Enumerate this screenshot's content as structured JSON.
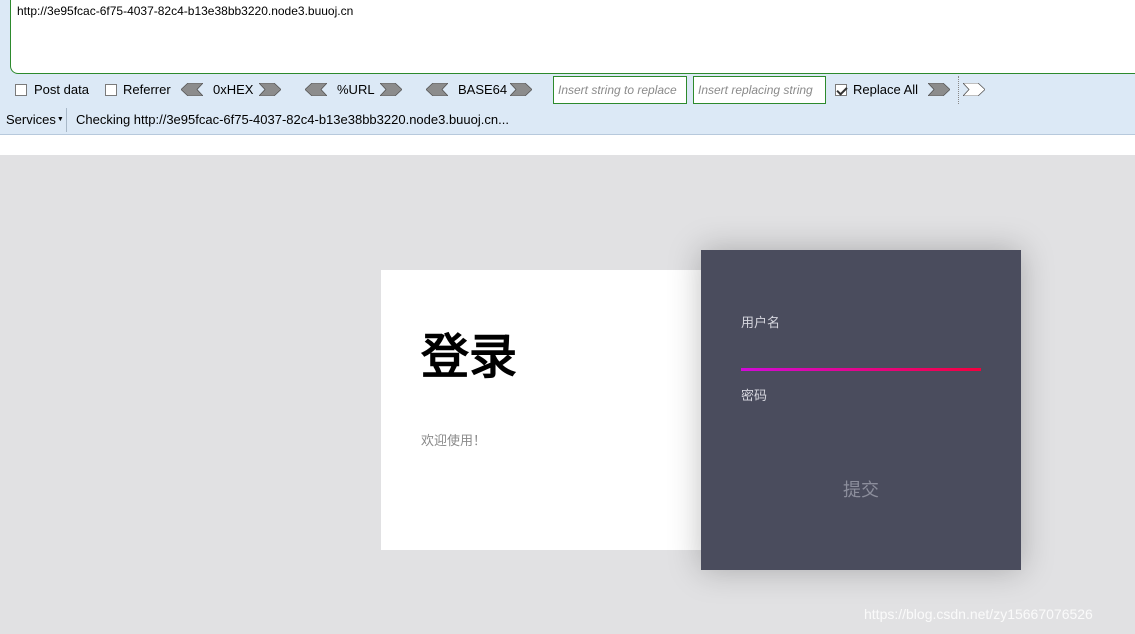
{
  "hackbar": {
    "url": "http://3e95fcac-6f75-4037-82c4-b13e38bb3220.node3.buuoj.cn",
    "post_data_label": "Post data",
    "post_data_checked": false,
    "referrer_label": "Referrer",
    "referrer_checked": false,
    "hex_label": "0xHEX",
    "url_label": "%URL",
    "base64_label": "BASE64",
    "replace_find_placeholder": "Insert string to replace",
    "replace_with_placeholder": "Insert replacing string",
    "replace_all_label": "Replace All",
    "replace_all_checked": true,
    "services_label": "Services",
    "status_text": "Checking http://3e95fcac-6f75-4037-82c4-b13e38bb3220.node3.buuoj.cn..."
  },
  "login": {
    "title": "登录",
    "subtitle": "欢迎使用！",
    "username_label": "用户名",
    "password_label": "密码",
    "submit_label": "提交"
  },
  "watermark": "https://blog.csdn.net/zy15667076526",
  "colors": {
    "toolbar_bg": "#dce9f6",
    "page_bg": "#e1e1e3",
    "panel_dark": "#4a4c5d",
    "gradient_start": "#d10ad8",
    "gradient_end": "#f4003e",
    "field_border": "#2d8a2d"
  }
}
